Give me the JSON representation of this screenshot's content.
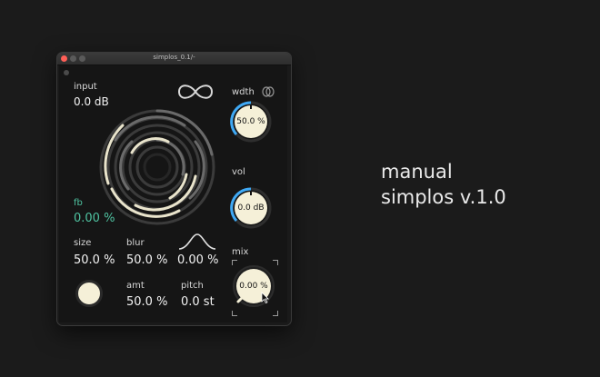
{
  "window": {
    "title": "simplos_0.1/-"
  },
  "plugin": {
    "input": {
      "label": "input",
      "value": "0.0 dB"
    },
    "fb": {
      "label": "fb",
      "value": "0.00 %"
    },
    "size": {
      "label": "size",
      "value": "50.0 %"
    },
    "blur": {
      "label": "blur",
      "value": "50.0 %"
    },
    "shape": {
      "value": "0.00 %"
    },
    "amt": {
      "label": "amt",
      "value": "50.0 %"
    },
    "pitch": {
      "label": "pitch",
      "value": "0.0 st"
    },
    "width": {
      "label": "wdth",
      "value": "50.0 %",
      "level": 0.5
    },
    "vol": {
      "label": "vol",
      "value": "0.0 dB",
      "level": 0.5
    },
    "mix": {
      "label": "mix",
      "value": "0.00 %",
      "level": 0.0
    }
  },
  "overlay": {
    "line1": "manual",
    "line2": "simplos v.1.0"
  },
  "colors": {
    "accent": "#3fa9f5",
    "green": "#4fc3a1",
    "knob": "#f5f0d8"
  },
  "icons": [
    "infinity-icon",
    "stereo-link-icon",
    "bell-curve-icon",
    "cursor-arrow-icon"
  ]
}
